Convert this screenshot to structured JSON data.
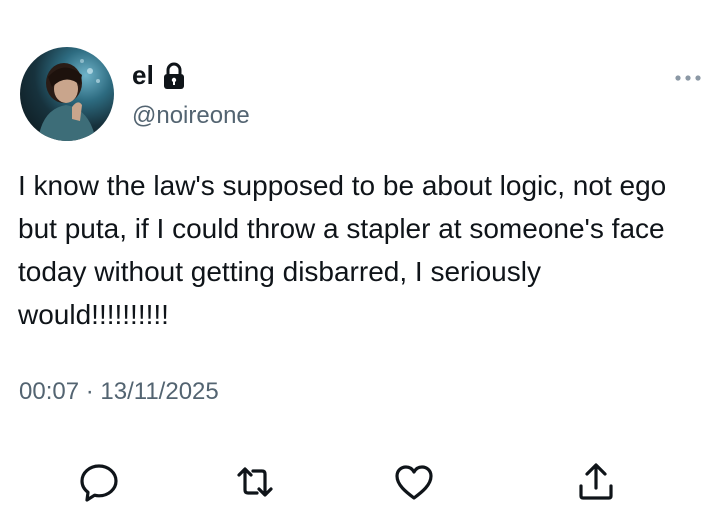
{
  "user": {
    "display_name": "el",
    "handle": "@noireone",
    "protected": true,
    "avatar": "profile-photo"
  },
  "tweet": {
    "text": "I know the law's supposed to be about logic, not ego but puta, if I could throw a stapler at someone's face today without getting disbarred, I seriously would!!!!!!!!!!",
    "time": "00:07",
    "separator": "·",
    "date": "13/11/2025"
  },
  "icons": {
    "more": "more-horizontal-icon",
    "reply": "reply-bubble-icon",
    "retweet": "retweet-icon",
    "like": "heart-icon",
    "share": "share-upload-icon"
  },
  "colors": {
    "text": "#0f1419",
    "secondary": "#536471",
    "background": "#ffffff"
  }
}
